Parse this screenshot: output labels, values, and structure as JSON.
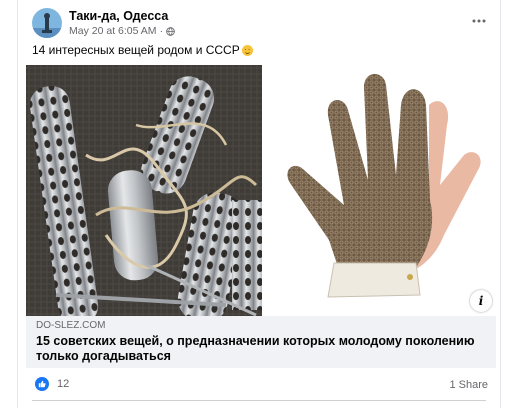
{
  "post": {
    "page_name": "Таки-да, Одесса",
    "timestamp": "May 20 at 6:05 AM",
    "separator": "·",
    "privacy_icon": "globe-icon",
    "more_icon": "more-options-icon",
    "text": "14 интересных вещей родом и СССР",
    "emoji": "grinning-face-emoji"
  },
  "link_preview": {
    "domain": "DO-SLEZ.COM",
    "title": "15 советских вещей, о предназначении которых молодому поколению только догадываться",
    "info_label": "i"
  },
  "footer": {
    "reaction_icon": "like-icon",
    "reaction_count": "12",
    "shares": "1 Share"
  },
  "colors": {
    "brand_blue": "#1877f2",
    "secondary_text": "#65676b",
    "preview_bg": "#f0f2f5"
  }
}
